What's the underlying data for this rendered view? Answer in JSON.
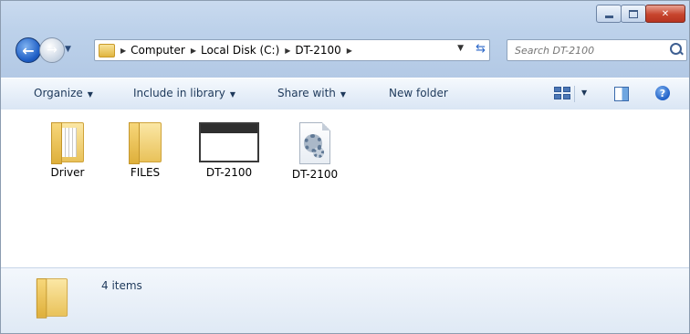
{
  "window": {
    "folder_name": "DT-2100"
  },
  "address": {
    "crumbs": [
      "Computer",
      "Local Disk (C:)",
      "DT-2100"
    ]
  },
  "search": {
    "placeholder": "Search DT-2100"
  },
  "toolbar": {
    "organize": "Organize",
    "include_in_library": "Include in library",
    "share_with": "Share with",
    "new_folder": "New folder"
  },
  "items": [
    {
      "label": "Driver",
      "icon": "folder-with-documents-icon"
    },
    {
      "label": "FILES",
      "icon": "folder-icon"
    },
    {
      "label": "DT-2100",
      "icon": "application-window-icon"
    },
    {
      "label": "DT-2100",
      "icon": "settings-file-icon"
    }
  ],
  "details": {
    "item_count": "4 items"
  },
  "colors": {
    "chrome": "#bcd1ea",
    "accent": "#1f5fc6",
    "close": "#c7442d"
  }
}
